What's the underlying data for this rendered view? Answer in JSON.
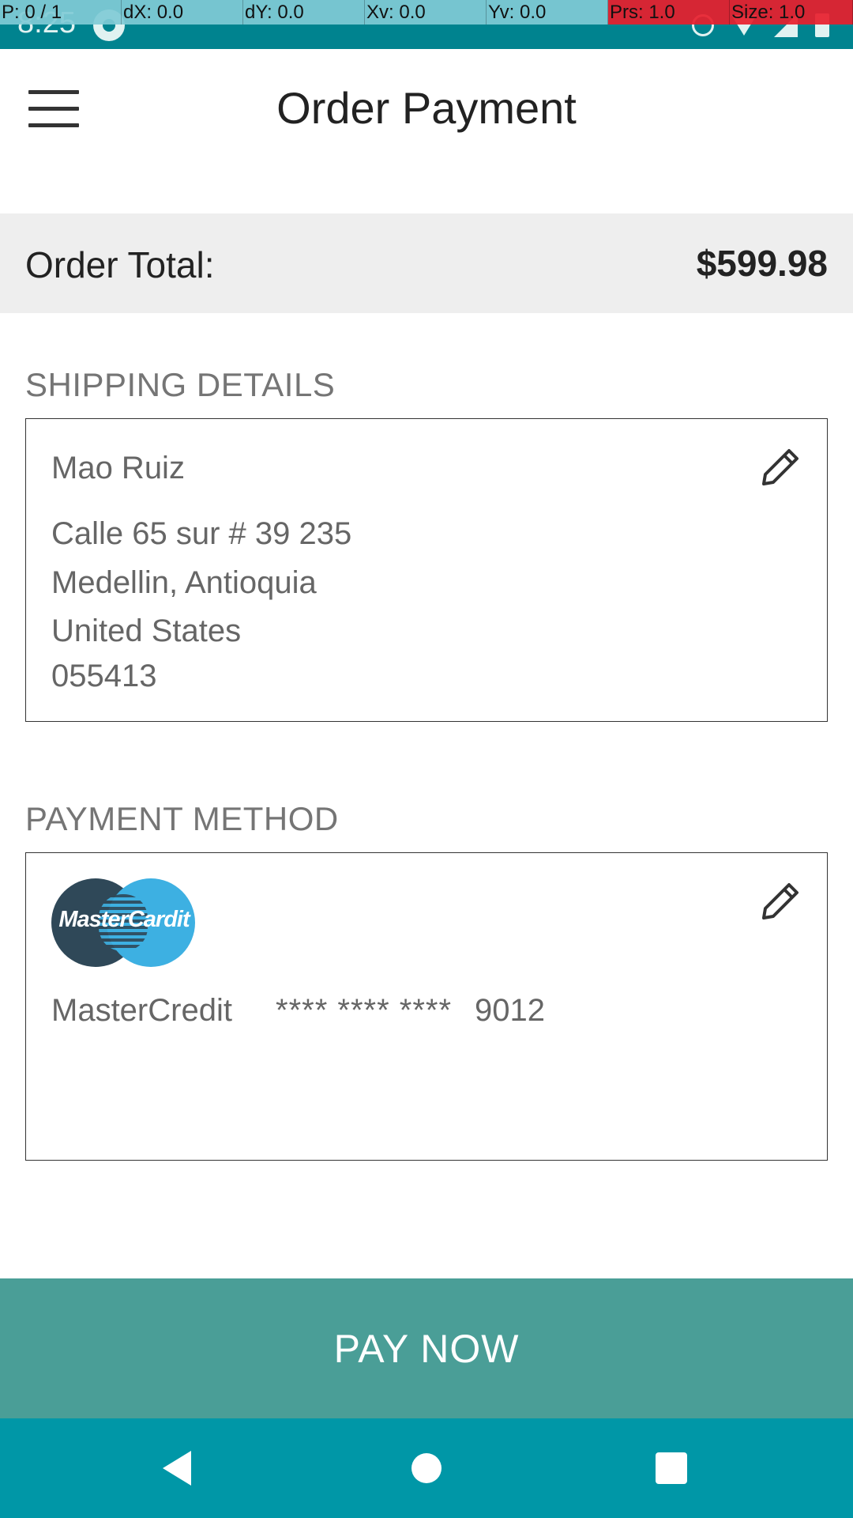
{
  "status_bar": {
    "time": "8:25"
  },
  "debug_overlay": {
    "pointer": "P: 0 / 1",
    "dx": "dX: 0.0",
    "dy": "dY: 0.0",
    "xv": "Xv: 0.0",
    "yv": "Yv: 0.0",
    "prs": "Prs: 1.0",
    "size": "Size: 1.0"
  },
  "app_bar": {
    "title": "Order Payment",
    "menu_icon": "hamburger-menu-icon"
  },
  "order_total": {
    "label": "Order Total:",
    "value": "$599.98"
  },
  "shipping": {
    "header": "SHIPPING DETAILS",
    "name": "Mao Ruiz",
    "address_line1": "Calle 65 sur # 39 235",
    "address_line2": "Medellin, Antioquia",
    "country": "United States",
    "postal_code": "055413",
    "edit_icon": "pencil-icon"
  },
  "payment": {
    "header": "PAYMENT METHOD",
    "logo_text": "MasterCardit",
    "card_brand": "MasterCredit",
    "card_mask": "**** **** ****",
    "card_last4": "9012",
    "edit_icon": "pencil-icon"
  },
  "pay_button": {
    "label": "PAY NOW"
  },
  "nav_bar": {
    "back_icon": "back-triangle-icon",
    "home_icon": "home-circle-icon",
    "recents_icon": "recents-square-icon"
  },
  "colors": {
    "status_bar": "#00838f",
    "nav_bar": "#0097a7",
    "pay_button": "#4a9e97",
    "total_bar": "#eeeeee",
    "debug_alert": "#e81e2c"
  }
}
